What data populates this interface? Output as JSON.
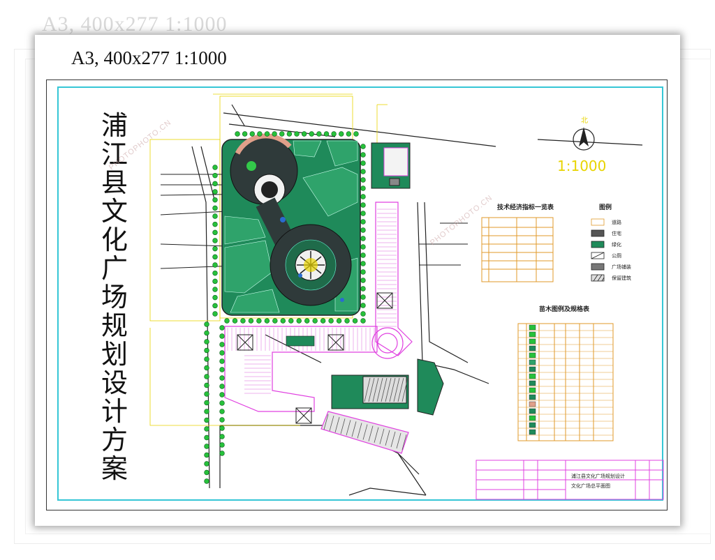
{
  "sheet": {
    "ghost_title": "A3, 400x277 1:1000",
    "title": "A3, 400x277 1:1000"
  },
  "drawing": {
    "main_title": "浦江县文化广场规划设计方案",
    "north_label": "北",
    "scale": "1:1000",
    "colors": {
      "frame": "#35c6d6",
      "green": "#1f8a5a",
      "dark": "#2f3a3a",
      "magenta": "#e040e0",
      "yellow": "#e8d400",
      "tree": "#27c13b"
    }
  },
  "tech_table": {
    "title": "技术经济指标一览表"
  },
  "legend": {
    "title": "图例",
    "items": [
      "道路",
      "住宅",
      "绿化",
      "公厕",
      "广场铺装",
      "保留建筑"
    ]
  },
  "plant_table": {
    "title": "苗木图例及规格表"
  },
  "title_block": {
    "project": "浦江县文化广场规划设计",
    "drawing": "文化广场总平面图"
  },
  "watermarks": [
    "PHOTOPHOTO.CN",
    "PHOTOPHOTO.CN"
  ]
}
